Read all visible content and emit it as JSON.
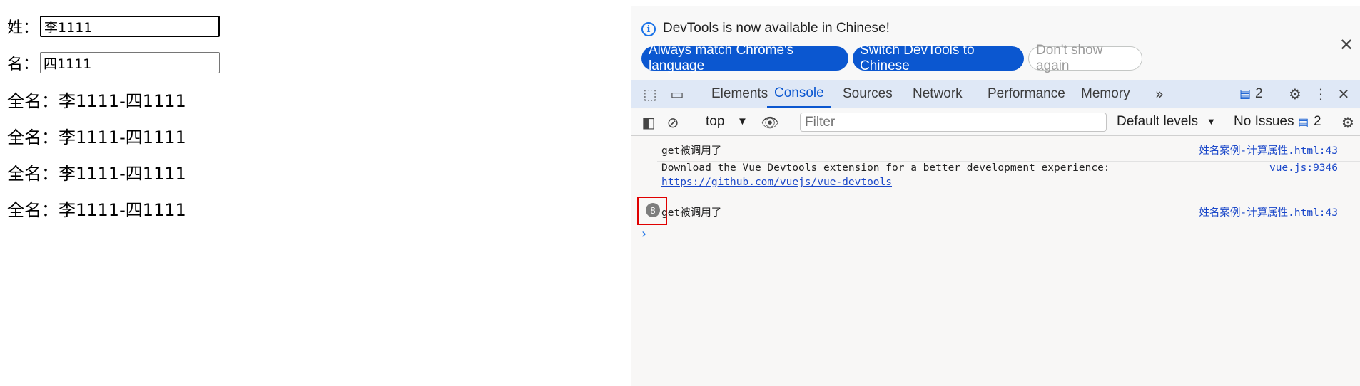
{
  "page": {
    "surname_label": "姓：",
    "surname_value": "李1111",
    "given_label": "名：",
    "given_value": "四1111",
    "fullname_lines": [
      "全名：李1111-四1111",
      "全名：李1111-四1111",
      "全名：李1111-四1111",
      "全名：李1111-四1111"
    ]
  },
  "devtools": {
    "banner": {
      "title": "DevTools is now available in Chinese!",
      "btn_match": "Always match Chrome's language",
      "btn_switch": "Switch DevTools to Chinese",
      "btn_dismiss": "Don't show again"
    },
    "tabs": [
      "Elements",
      "Console",
      "Sources",
      "Network",
      "Performance",
      "Memory"
    ],
    "active_tab": "Console",
    "issues_count": "2",
    "toolbar": {
      "context": "top",
      "filter_placeholder": "Filter",
      "levels": "Default levels",
      "no_issues": "No Issues",
      "issues_count": "2"
    },
    "messages": [
      {
        "text": "get被调用了",
        "source": "姓名案例-计算属性.html:43"
      },
      {
        "text": "Download the Vue Devtools extension for a better development experience:",
        "link": "https://github.com/vuejs/vue-devtools",
        "source": "vue.js:9346"
      },
      {
        "text": "get被调用了",
        "source": "姓名案例-计算属性.html:43",
        "repeat": "8"
      }
    ],
    "colors": {
      "accent": "#0b57d0",
      "highlight": "#e00000"
    }
  }
}
